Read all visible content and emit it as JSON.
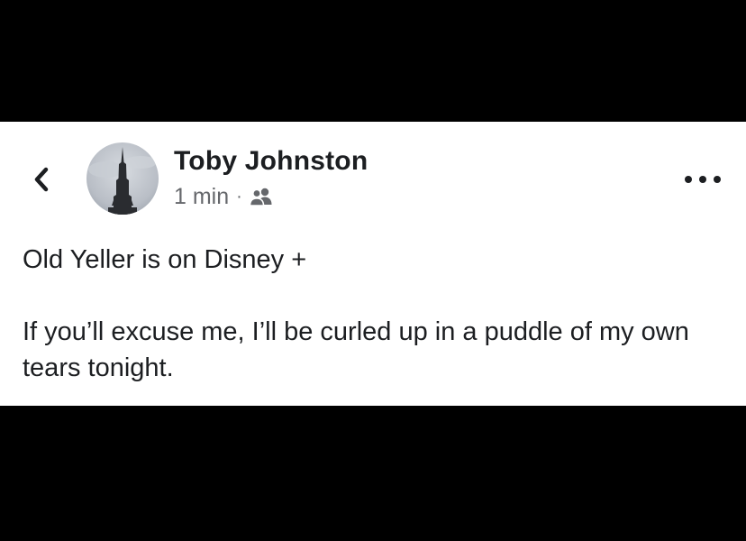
{
  "post": {
    "author": "Toby Johnston",
    "time": "1 min",
    "separator": "·",
    "audience_icon": "friends-icon",
    "back_icon": "chevron-left-icon",
    "more_icon": "more-horizontal-icon",
    "paragraphs": [
      "Old Yeller is on Disney +",
      "If you’ll excuse me, I’ll be curled up in a puddle of my own tears tonight."
    ]
  }
}
